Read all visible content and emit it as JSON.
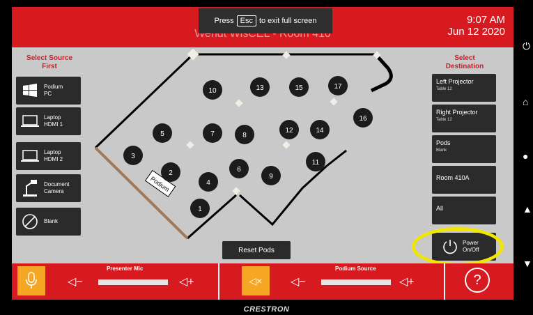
{
  "header": {
    "room_title": "Wendt WisCEL - Room 410",
    "time": "9:07 AM",
    "date": "Jun 12 2020"
  },
  "fullscreen_toast": {
    "press": "Press",
    "key": "Esc",
    "rest": "to exit full screen"
  },
  "left": {
    "heading_line1": "Select Source",
    "heading_line2": "First",
    "sources": [
      {
        "line1": "Podium",
        "line2": "PC",
        "icon": "windows-icon"
      },
      {
        "line1": "Laptop",
        "line2": "HDMI 1",
        "icon": "laptop-icon"
      },
      {
        "line1": "Laptop",
        "line2": "HDMI 2",
        "icon": "laptop-icon"
      },
      {
        "line1": "Document",
        "line2": "Camera",
        "icon": "document-camera-icon"
      },
      {
        "line1": "Blank",
        "line2": "",
        "icon": "blank-icon"
      }
    ]
  },
  "right": {
    "heading_line1": "Select",
    "heading_line2": "Destination",
    "destinations": [
      {
        "label": "Left Projector",
        "sub": "Table 12"
      },
      {
        "label": "Right Projector",
        "sub": "Table 12"
      },
      {
        "label": "Pods",
        "sub": "Blank"
      },
      {
        "label": "Room 410A",
        "sub": ""
      },
      {
        "label": "All",
        "sub": ""
      }
    ]
  },
  "floor": {
    "podium_label": "Podium",
    "pods": [
      "1",
      "2",
      "3",
      "4",
      "5",
      "6",
      "7",
      "8",
      "9",
      "10",
      "11",
      "12",
      "13",
      "14",
      "15",
      "16",
      "17"
    ]
  },
  "reset_label": "Reset Pods",
  "power": {
    "line1": "Power",
    "line2": "On/Off"
  },
  "audio": {
    "presenter_mic_label": "Presenter Mic",
    "podium_source_label": "Podium Source",
    "volume_down": "◁−",
    "volume_up": "◁+",
    "mute_glyph": "◁×"
  },
  "help_label": "?",
  "brand": "CRESTRON",
  "hardware_buttons": [
    "power-icon",
    "home-icon",
    "light-icon",
    "up-arrow-icon",
    "down-arrow-icon"
  ],
  "colors": {
    "accent_red": "#d71920",
    "button_dark": "#2b2b2b",
    "mute_orange": "#f5a623",
    "highlight_yellow": "#f2e600"
  }
}
